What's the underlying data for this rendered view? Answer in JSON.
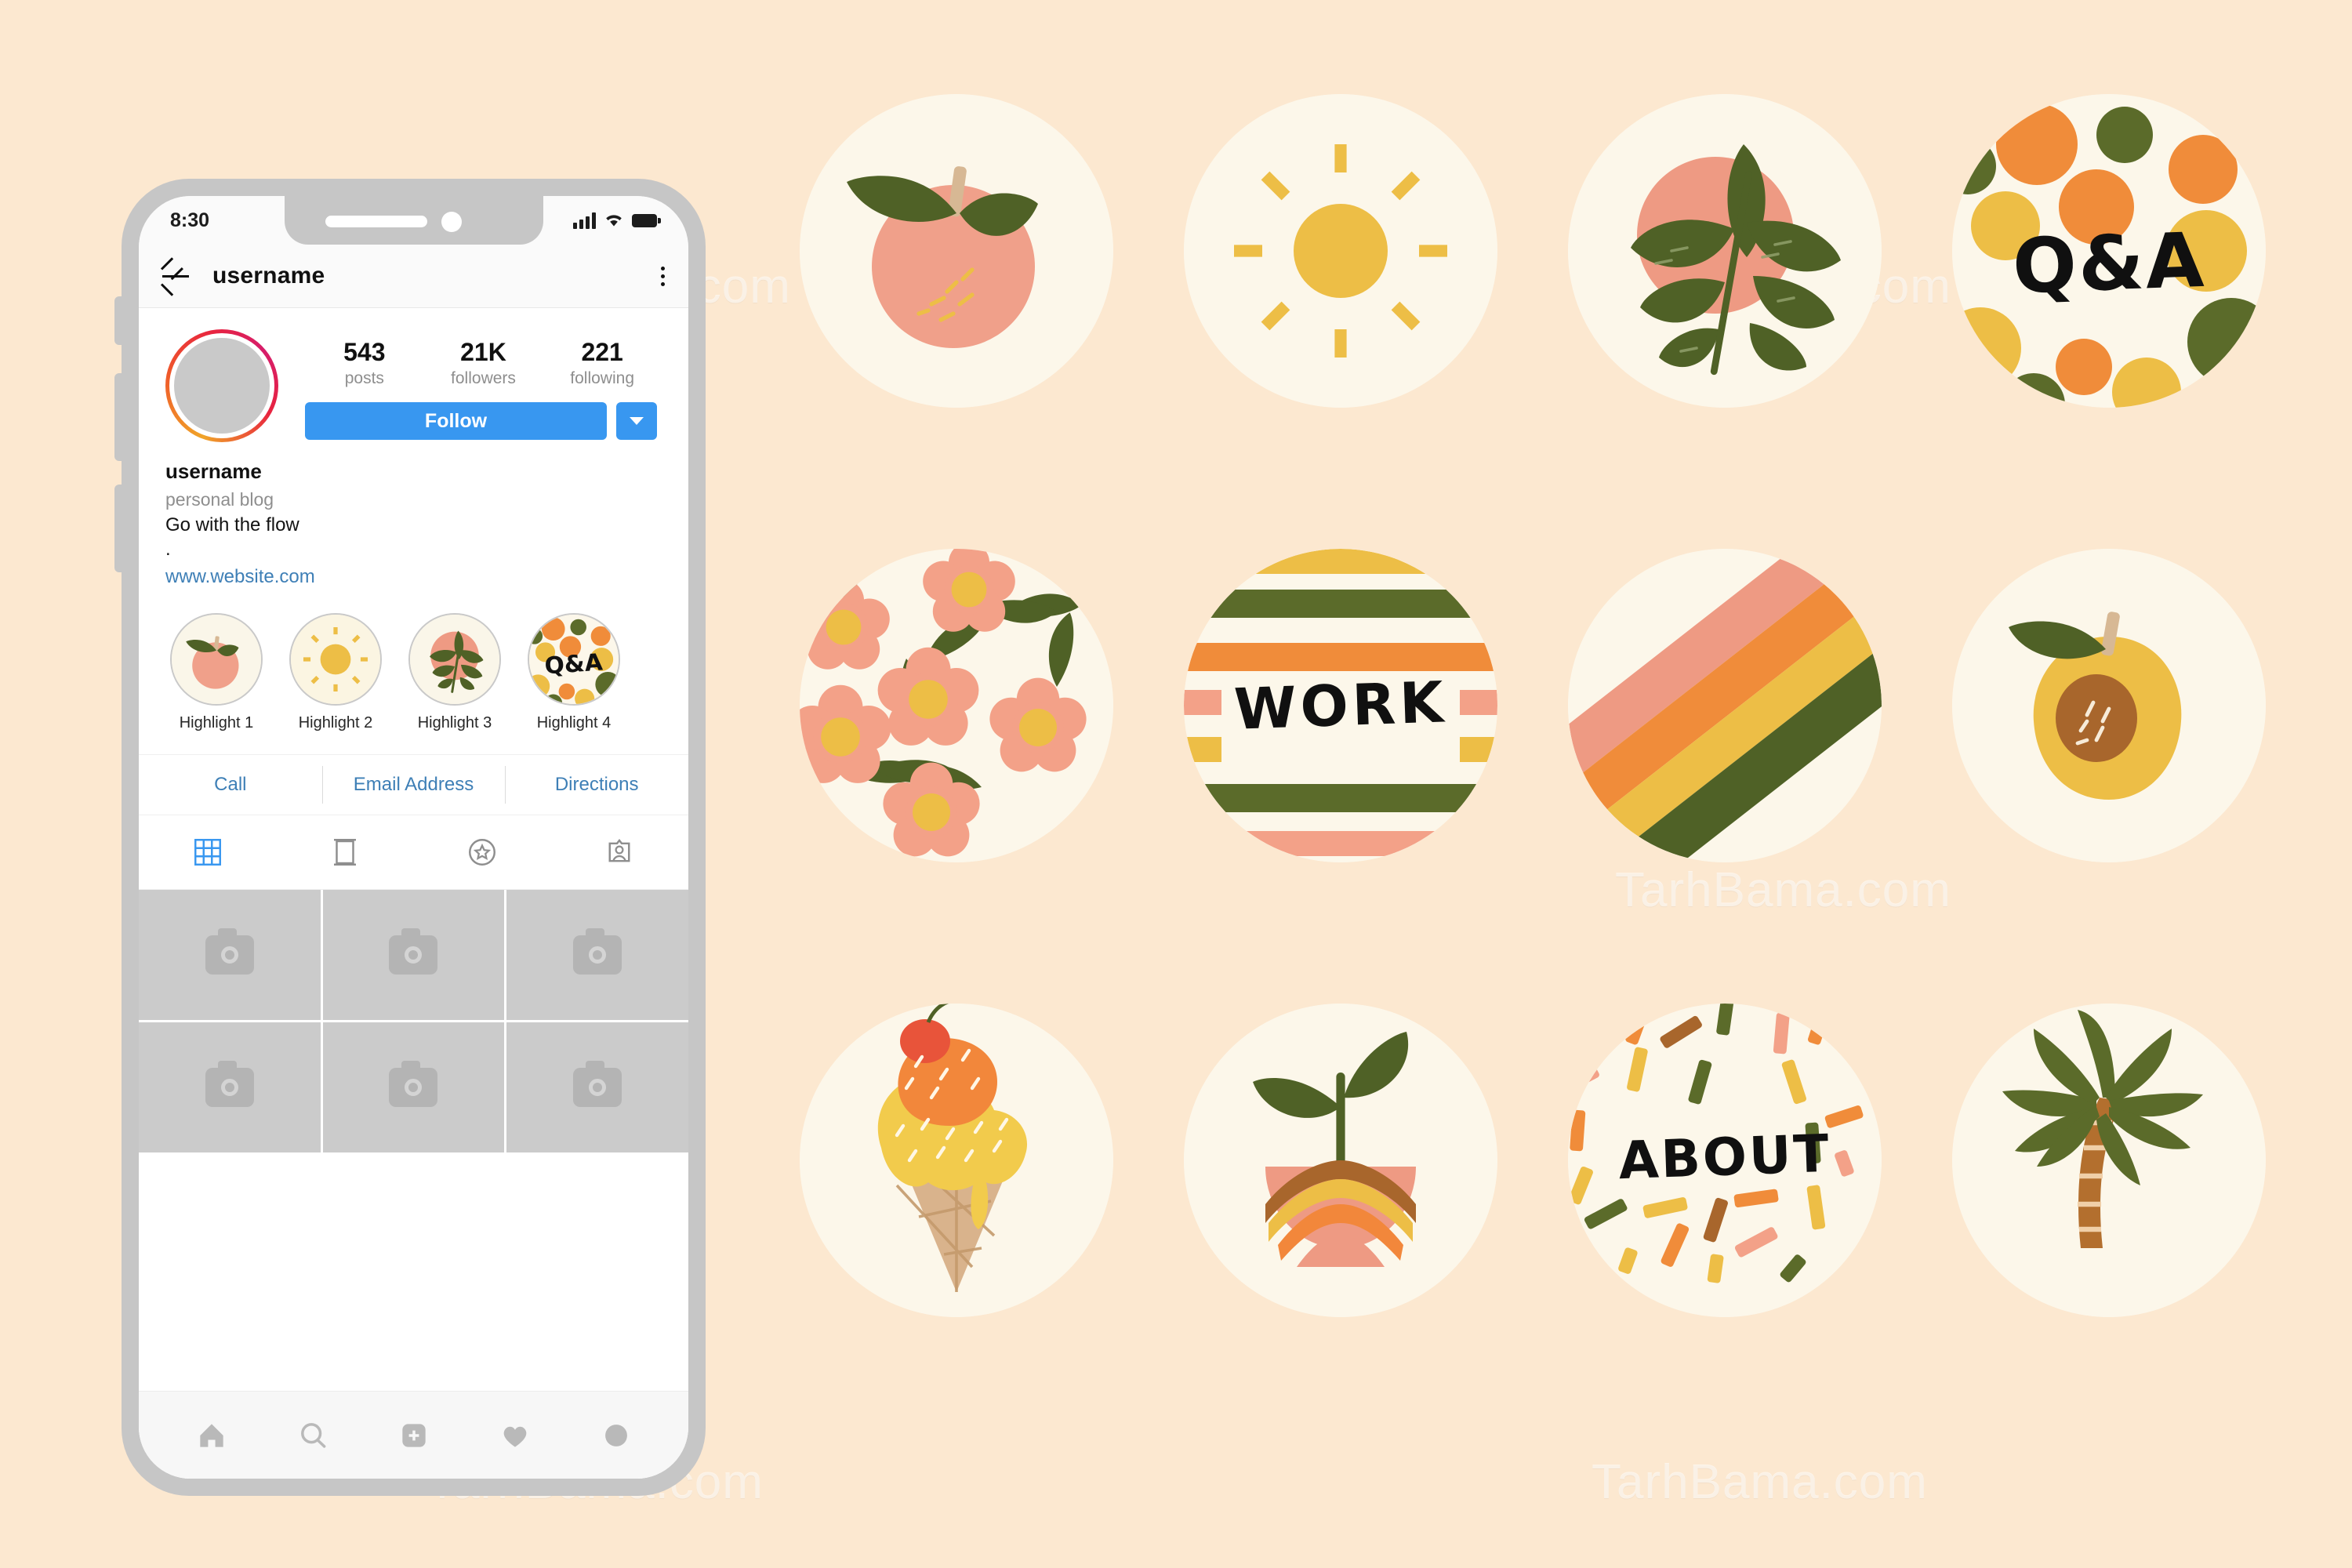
{
  "page": {
    "background_color": "#FCE8D0",
    "watermark_text": "TarhBama.com"
  },
  "phone": {
    "status_bar": {
      "time": "8:30",
      "signal_icon": "signal-bars-icon",
      "wifi_icon": "wifi-icon",
      "battery_icon": "battery-icon"
    },
    "app_bar": {
      "back_icon": "back-arrow-icon",
      "title": "username",
      "menu_icon": "kebab-menu-icon"
    },
    "profile": {
      "avatar_label": "profile-photo",
      "stats": [
        {
          "value": "543",
          "label": "posts"
        },
        {
          "value": "21K",
          "label": "followers"
        },
        {
          "value": "221",
          "label": "following"
        }
      ],
      "follow_label": "Follow",
      "dropdown_icon": "chevron-down-icon",
      "name": "username",
      "category": "personal blog",
      "bio_line": "Go with the flow",
      "bio_dot": ".",
      "website": "www.website.com"
    },
    "highlights": [
      {
        "label": "Highlight 1",
        "cover": "peach"
      },
      {
        "label": "Highlight 2",
        "cover": "sun"
      },
      {
        "label": "Highlight 3",
        "cover": "leaf"
      },
      {
        "label": "Highlight 4",
        "cover": "qanda"
      }
    ],
    "actions": [
      {
        "label": "Call"
      },
      {
        "label": "Email Address"
      },
      {
        "label": "Directions"
      }
    ],
    "tabs": [
      {
        "icon": "grid-icon",
        "active": true
      },
      {
        "icon": "reels-icon",
        "active": false
      },
      {
        "icon": "star-circle-icon",
        "active": false
      },
      {
        "icon": "tagged-person-icon",
        "active": false
      }
    ],
    "grid_placeholder_icon": "camera-icon",
    "grid_cell_count": 6,
    "bottom_nav": [
      {
        "icon": "home-icon"
      },
      {
        "icon": "search-icon"
      },
      {
        "icon": "add-post-icon"
      },
      {
        "icon": "heart-icon"
      },
      {
        "icon": "profile-avatar-icon"
      }
    ]
  },
  "gallery": {
    "items": [
      {
        "name": "peach-cover",
        "type": "peach",
        "row": 0,
        "col": 0
      },
      {
        "name": "sun-cover",
        "type": "sun",
        "row": 0,
        "col": 1
      },
      {
        "name": "leaf-cover",
        "type": "leaf",
        "row": 0,
        "col": 2
      },
      {
        "name": "qanda-cover",
        "type": "qanda",
        "row": 0,
        "col": 3,
        "text": "Q&A"
      },
      {
        "name": "floral-cover",
        "type": "floral",
        "row": 1,
        "col": 0
      },
      {
        "name": "work-cover",
        "type": "stripes",
        "row": 1,
        "col": 1,
        "text": "WORK"
      },
      {
        "name": "rainbow-cover",
        "type": "rainbow",
        "row": 1,
        "col": 2
      },
      {
        "name": "apricot-cover",
        "type": "apricot",
        "row": 1,
        "col": 3
      },
      {
        "name": "icecream-cover",
        "type": "icecream",
        "row": 2,
        "col": 0
      },
      {
        "name": "plant-cover",
        "type": "plant",
        "row": 2,
        "col": 1
      },
      {
        "name": "about-cover",
        "type": "confetti",
        "row": 2,
        "col": 2,
        "text": "ABOUT"
      },
      {
        "name": "palm-cover",
        "type": "palm",
        "row": 2,
        "col": 3
      }
    ]
  },
  "colors": {
    "background": "#FCE8D0",
    "circle_cream": "#FCF7EA",
    "salmon": "#F2A08C",
    "coral": "#EE9A83",
    "orange": "#F08C3A",
    "yellow": "#EDBE46",
    "olive": "#5B6B2A",
    "brown": "#A8662C",
    "tan": "#D7B894",
    "instagram_blue": "#3897F0",
    "link_blue": "#3E7FB6",
    "phone_frame": "#C6C6C6"
  }
}
